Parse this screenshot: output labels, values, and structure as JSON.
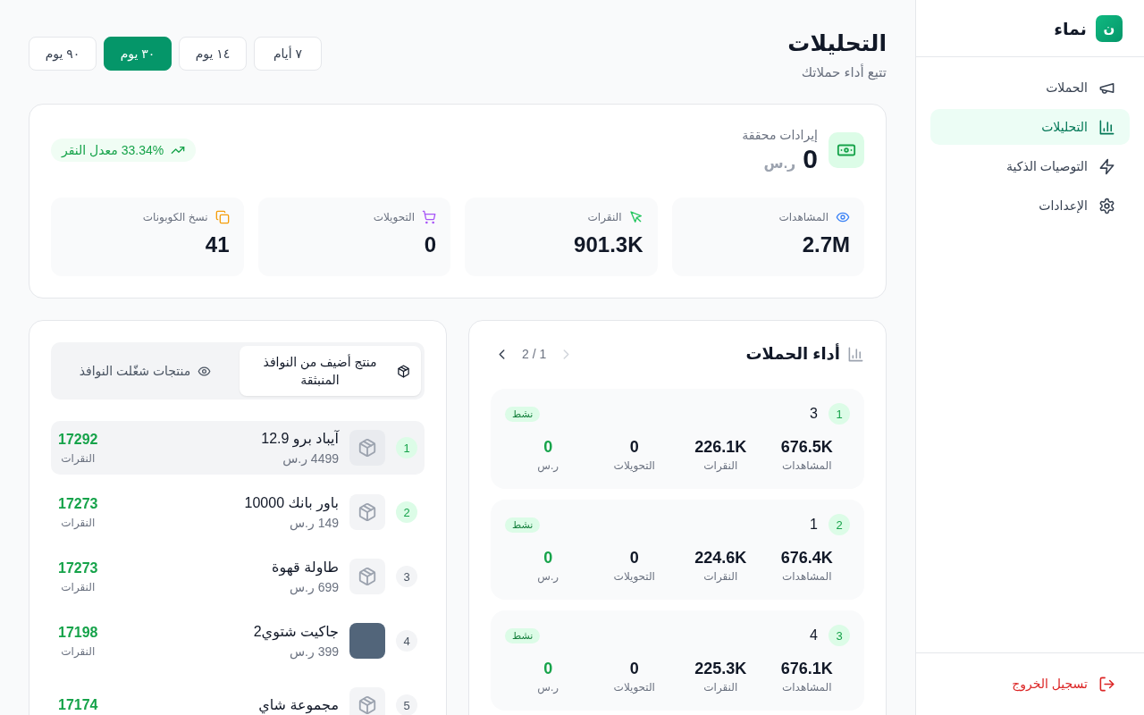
{
  "sidebar": {
    "logo_letter": "ن",
    "brand": "نماء",
    "items": [
      {
        "kind": "campaigns",
        "label": "الحملات",
        "selected": false
      },
      {
        "kind": "analytics",
        "label": "التحليلات",
        "selected": true
      },
      {
        "kind": "recommendations",
        "label": "التوصيات الذكية",
        "selected": false
      },
      {
        "kind": "settings",
        "label": "الإعدادات",
        "selected": false
      }
    ],
    "logout": "تسجيل الخروج"
  },
  "header": {
    "title": "التحليلات",
    "subtitle": "تتبع أداء حملاتك"
  },
  "date_ranges": [
    {
      "label": "٧ أيام",
      "selected": false
    },
    {
      "label": "١٤ يوم",
      "selected": false
    },
    {
      "label": "٣٠ يوم",
      "selected": true
    },
    {
      "label": "٩٠ يوم",
      "selected": false
    }
  ],
  "summary": {
    "revenue": {
      "label": "إيرادات محققة",
      "value": "0",
      "currency": "ر.س"
    },
    "click_rate": "33.34% معدل النقر",
    "stats": [
      {
        "kind": "views",
        "label": "المشاهدات",
        "value": "2.7M"
      },
      {
        "kind": "clicks",
        "label": "النقرات",
        "value": "901.3K"
      },
      {
        "kind": "conversions",
        "label": "التحويلات",
        "value": "0"
      },
      {
        "kind": "coupons",
        "label": "نسخ الكوبونات",
        "value": "41"
      }
    ]
  },
  "campaigns": {
    "title": "أداء الحملات",
    "page": "1 / 2",
    "prev_disabled": true,
    "next_disabled": false,
    "items": [
      {
        "rank": "1",
        "name": "3",
        "status": "نشط",
        "stats": [
          {
            "kind": "views",
            "value": "676.5K",
            "label": "المشاهدات"
          },
          {
            "kind": "clicks",
            "value": "226.1K",
            "label": "النقرات"
          },
          {
            "kind": "conversions",
            "value": "0",
            "label": "التحويلات"
          },
          {
            "kind": "revenue",
            "value": "0",
            "label": "ر.س"
          }
        ]
      },
      {
        "rank": "2",
        "name": "1",
        "status": "نشط",
        "stats": [
          {
            "kind": "views",
            "value": "676.4K",
            "label": "المشاهدات"
          },
          {
            "kind": "clicks",
            "value": "224.6K",
            "label": "النقرات"
          },
          {
            "kind": "conversions",
            "value": "0",
            "label": "التحويلات"
          },
          {
            "kind": "revenue",
            "value": "0",
            "label": "ر.س"
          }
        ]
      },
      {
        "rank": "3",
        "name": "4",
        "status": "نشط",
        "stats": [
          {
            "kind": "views",
            "value": "676.1K",
            "label": "المشاهدات"
          },
          {
            "kind": "clicks",
            "value": "225.3K",
            "label": "النقرات"
          },
          {
            "kind": "conversions",
            "value": "0",
            "label": "التحويلات"
          },
          {
            "kind": "revenue",
            "value": "0",
            "label": "ر.س"
          }
        ]
      }
    ]
  },
  "products": {
    "tabs": [
      {
        "kind": "added",
        "label": "منتج أضيف من النوافذ المنبثقة",
        "selected": true
      },
      {
        "kind": "triggered",
        "label": "منتجات شغّلت النوافذ",
        "selected": false
      }
    ],
    "items": [
      {
        "rank": "1",
        "top": true,
        "selected": true,
        "kind": "placeholder",
        "name": "آيباد برو 12.9",
        "price": "4499 ر.س",
        "clicks": "17292",
        "clicks_label": "النقرات"
      },
      {
        "rank": "2",
        "top": true,
        "selected": false,
        "kind": "placeholder",
        "name": "باور بانك 10000",
        "price": "149 ر.س",
        "clicks": "17273",
        "clicks_label": "النقرات"
      },
      {
        "rank": "3",
        "top": false,
        "selected": false,
        "kind": "placeholder",
        "name": "طاولة قهوة",
        "price": "699 ر.س",
        "clicks": "17273",
        "clicks_label": "النقرات"
      },
      {
        "rank": "4",
        "top": false,
        "selected": false,
        "kind": "photo",
        "name": "جاكيت شتوي2",
        "price": "399 ر.س",
        "clicks": "17198",
        "clicks_label": "النقرات"
      },
      {
        "rank": "5",
        "top": false,
        "selected": false,
        "kind": "placeholder",
        "name": "مجموعة شاي",
        "clicks": "17174"
      }
    ]
  }
}
